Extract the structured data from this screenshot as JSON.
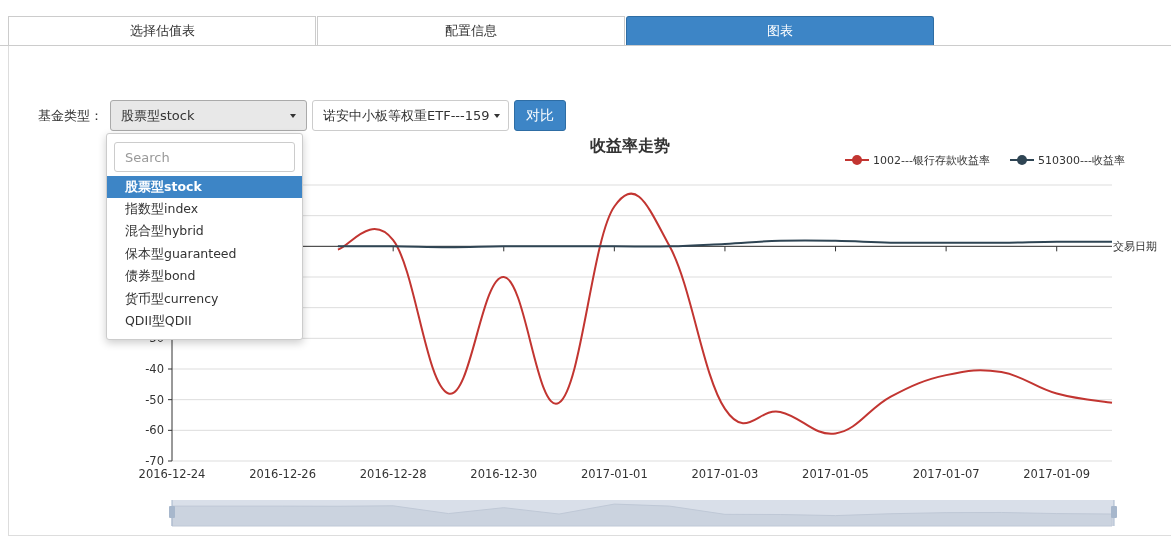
{
  "tabs": [
    {
      "label": "选择估值表",
      "selected": false
    },
    {
      "label": "配置信息",
      "selected": false
    },
    {
      "label": "图表",
      "selected": true
    }
  ],
  "filter": {
    "label": "基金类型：",
    "fund_type": {
      "value": "股票型stock",
      "expanded": true,
      "search_placeholder": "Search",
      "options": [
        {
          "label": "股票型stock",
          "selected": true
        },
        {
          "label": "指数型index",
          "selected": false
        },
        {
          "label": "混合型hybrid",
          "selected": false
        },
        {
          "label": "保本型guaranteed",
          "selected": false
        },
        {
          "label": "债券型bond",
          "selected": false
        },
        {
          "label": "货币型currency",
          "selected": false
        },
        {
          "label": "QDII型QDII",
          "selected": false
        }
      ]
    },
    "fund": {
      "value": "诺安中小板等权重ETF---159"
    },
    "compare_button": "对比"
  },
  "chart": {
    "chart_data": {
      "type": "line",
      "title": "收益率走势",
      "xlabel": "交易日期",
      "grid": true,
      "legend": "top-right",
      "categories": [
        "2016-12-24",
        null,
        "2016-12-26",
        null,
        "2016-12-28",
        null,
        "2016-12-30",
        null,
        "2017-01-01",
        null,
        "2017-01-03",
        null,
        "2017-01-05",
        null,
        "2017-01-07",
        null,
        "2017-01-09",
        null
      ],
      "series": [
        {
          "name": "1002---银行存款收益率",
          "color": "#c23531",
          "values": [
            null,
            null,
            null,
            -1,
            2,
            -48,
            -10,
            -51,
            13,
            0,
            -53,
            -54,
            -61,
            -49,
            -42,
            -41,
            -48,
            -51
          ]
        },
        {
          "name": "510300---收益率",
          "color": "#2f4554",
          "values": [
            null,
            null,
            null,
            0,
            0,
            -0.3,
            0,
            0,
            0,
            0,
            0.8,
            1.8,
            1.8,
            1.2,
            1.2,
            1.2,
            1.5,
            1.5
          ]
        }
      ],
      "ylim": [
        -70,
        20
      ],
      "yticks": [
        -70,
        -60,
        -50,
        -40,
        -30
      ]
    }
  }
}
